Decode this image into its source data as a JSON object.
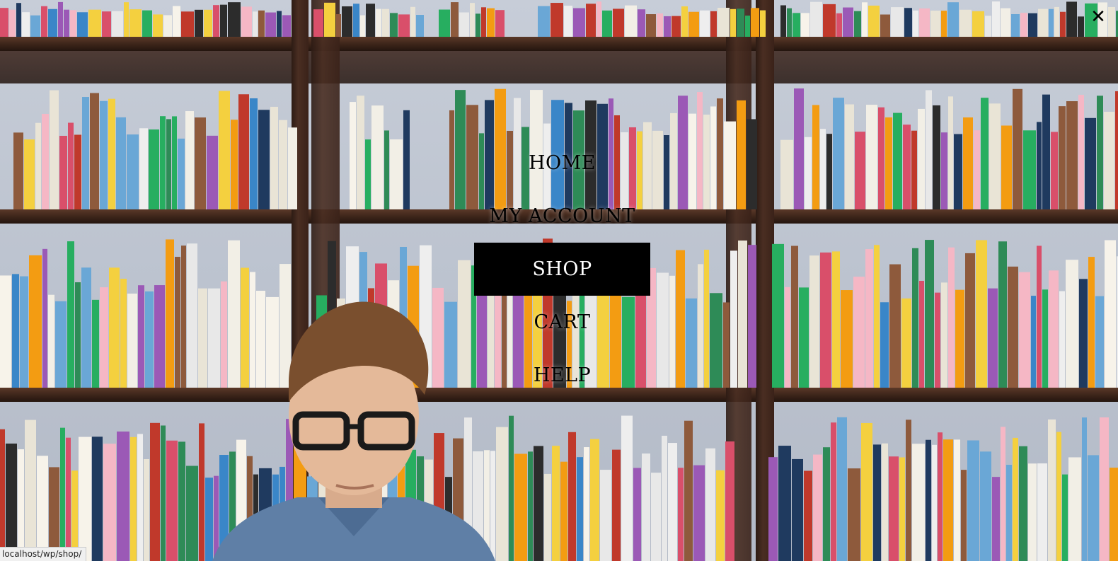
{
  "menu": {
    "items": [
      {
        "label": "HOME",
        "active": false
      },
      {
        "label": "MY ACCOUNT",
        "active": false
      },
      {
        "label": "SHOP",
        "active": true
      },
      {
        "label": "CART",
        "active": false
      },
      {
        "label": "HELP",
        "active": false
      }
    ],
    "close_icon": "close-icon",
    "close_glyph": "✕"
  },
  "status_bar": {
    "url": "localhost/wp/shop/"
  },
  "colors": {
    "active_bg": "#000000",
    "active_text": "#ffffff",
    "text": "#000000",
    "shelf_wood": "#3b2419"
  }
}
